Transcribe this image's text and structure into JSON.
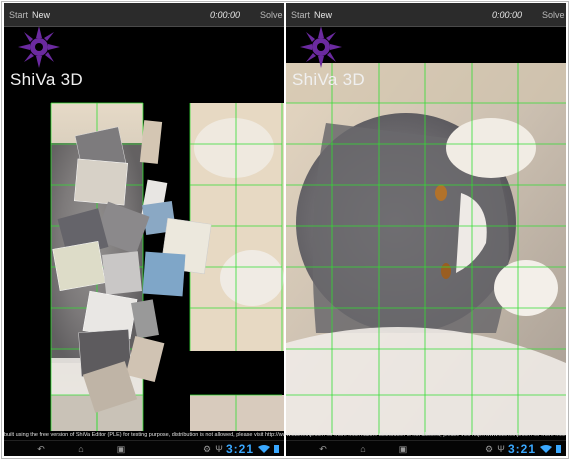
{
  "left_screen": {
    "toolbar": {
      "start_label": "Start",
      "new_label": "New",
      "timer": "0:00:00",
      "solve_label": "Solve"
    },
    "brand": "ShiVa 3D",
    "clock": "3:21"
  },
  "right_screen": {
    "toolbar": {
      "start_label": "Start",
      "new_label": "New",
      "timer": "0:00:00",
      "solve_label": "Solve"
    },
    "brand": "ShiVa 3D",
    "clock": "3:21"
  },
  "footer_text": "built using the free version of ShiVa Editor (PLE) for testing purpose, distribution is not allowed, please visit http://www.stonetrip.com for more information. distribution is not allowed, please visit http://www.stonetrip.com for more information.   This project has been built using the free version",
  "colors": {
    "grid_line": "#33dd33",
    "brand_purple": "#6b2aa0",
    "clock_blue": "#3aa8ff"
  },
  "icons": [
    "sun-logo-icon",
    "back-icon",
    "home-icon",
    "recent-apps-icon",
    "android-icon",
    "usb-icon",
    "wifi-icon",
    "battery-icon"
  ]
}
